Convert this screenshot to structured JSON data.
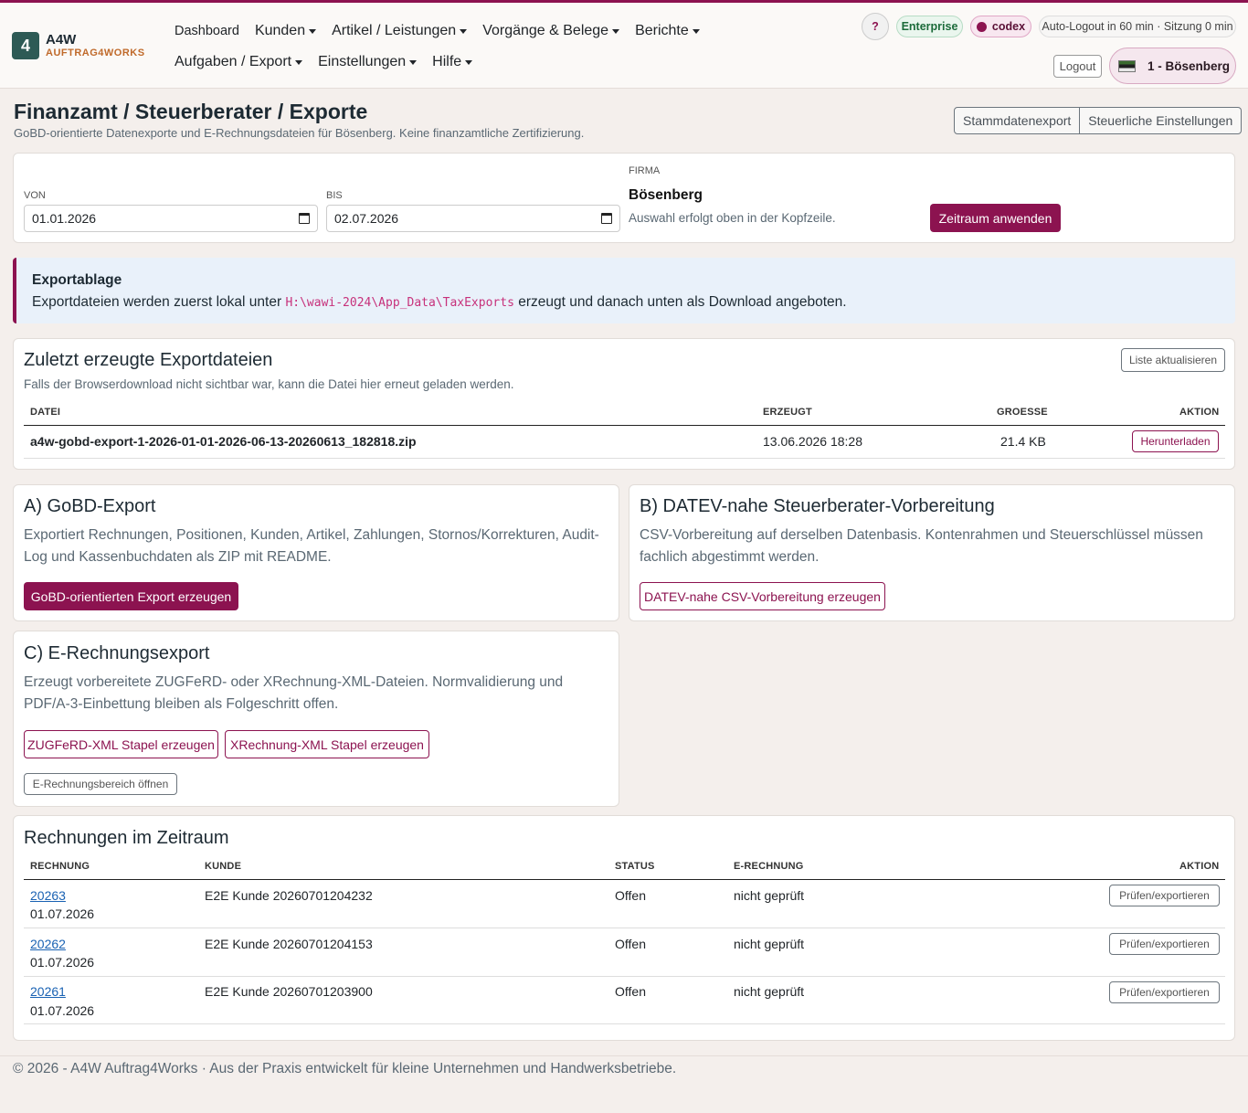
{
  "brand": {
    "mark": "4",
    "name": "A4W",
    "sub": "AUFTRAG4WORKS"
  },
  "nav": {
    "row1": [
      {
        "label": "Dashboard",
        "dropdown": false
      },
      {
        "label": "Kunden",
        "dropdown": true
      },
      {
        "label": "Artikel / Leistungen",
        "dropdown": true
      },
      {
        "label": "Vorgänge & Belege",
        "dropdown": true
      },
      {
        "label": "Berichte",
        "dropdown": true
      }
    ],
    "row2": [
      {
        "label": "Aufgaben / Export",
        "dropdown": true
      },
      {
        "label": "Einstellungen",
        "dropdown": true
      },
      {
        "label": "Hilfe",
        "dropdown": true
      }
    ]
  },
  "header": {
    "help": "?",
    "edition": "Enterprise",
    "user": "codex",
    "session": "Auto-Logout in 60 min · Sitzung 0 min",
    "logout": "Logout",
    "company": "1 - Bösenberg"
  },
  "page": {
    "title": "Finanzamt / Steuerberater / Exporte",
    "subtitle": "GoBD-orientierte Datenexporte und E-Rechnungsdateien für Bösenberg. Keine finanzamtliche Zertifizierung.",
    "btn_master": "Stammdatenexport",
    "btn_tax": "Steuerliche Einstellungen"
  },
  "filter": {
    "from_label": "Von",
    "from_value": "01.01.2026",
    "to_label": "Bis",
    "to_value": "02.07.2026",
    "firma_label": "Firma",
    "firma_name": "Bösenberg",
    "firma_hint": "Auswahl erfolgt oben in der Kopfzeile.",
    "apply": "Zeitraum anwenden"
  },
  "info": {
    "title": "Exportablage",
    "text_before": "Exportdateien werden zuerst lokal unter ",
    "path": "H:\\wawi-2024\\App_Data\\TaxExports",
    "text_after": " erzeugt und danach unten als Download angeboten."
  },
  "recent": {
    "title": "Zuletzt erzeugte Exportdateien",
    "hint": "Falls der Browserdownload nicht sichtbar war, kann die Datei hier erneut geladen werden.",
    "refresh": "Liste aktualisieren",
    "columns": [
      "Datei",
      "Erzeugt",
      "Groesse",
      "Aktion"
    ],
    "rows": [
      {
        "file": "a4w-gobd-export-1-2026-01-01-2026-06-13-20260613_182818.zip",
        "created": "13.06.2026 18:28",
        "size": "21.4 KB",
        "action": "Herunterladen"
      }
    ]
  },
  "gobd": {
    "title": "A) GoBD-Export",
    "text": "Exportiert Rechnungen, Positionen, Kunden, Artikel, Zahlungen, Stornos/Korrekturen, Audit-Log und Kassenbuchdaten als ZIP mit README.",
    "button": "GoBD-orientierten Export erzeugen"
  },
  "datev": {
    "title": "B) DATEV-nahe Steuerberater-Vorbereitung",
    "text": "CSV-Vorbereitung auf derselben Datenbasis. Kontenrahmen und Steuerschlüssel müssen fachlich abgestimmt werden.",
    "button": "DATEV-nahe CSV-Vorbereitung erzeugen"
  },
  "erech": {
    "title": "C) E-Rechnungsexport",
    "text": "Erzeugt vorbereitete ZUGFeRD- oder XRechnung-XML-Dateien. Normvalidierung und PDF/A-3-Einbettung bleiben als Folgeschritt offen.",
    "btn_zugferd": "ZUGFeRD-XML Stapel erzeugen",
    "btn_xrechnung": "XRechnung-XML Stapel erzeugen",
    "btn_area": "E-Rechnungsbereich öffnen"
  },
  "invoices": {
    "title": "Rechnungen im Zeitraum",
    "columns": [
      "Rechnung",
      "Kunde",
      "Status",
      "E-Rechnung",
      "Aktion"
    ],
    "rows": [
      {
        "number": "20263",
        "date": "01.07.2026",
        "customer": "E2E Kunde 20260701204232",
        "status": "Offen",
        "erech": "nicht geprüft",
        "action": "Prüfen/exportieren"
      },
      {
        "number": "20262",
        "date": "01.07.2026",
        "customer": "E2E Kunde 20260701204153",
        "status": "Offen",
        "erech": "nicht geprüft",
        "action": "Prüfen/exportieren"
      },
      {
        "number": "20261",
        "date": "01.07.2026",
        "customer": "E2E Kunde 20260701203900",
        "status": "Offen",
        "erech": "nicht geprüft",
        "action": "Prüfen/exportieren"
      }
    ]
  },
  "footer": "© 2026 - A4W Auftrag4Works · Aus der Praxis entwickelt für kleine Unternehmen und Handwerksbetriebe."
}
